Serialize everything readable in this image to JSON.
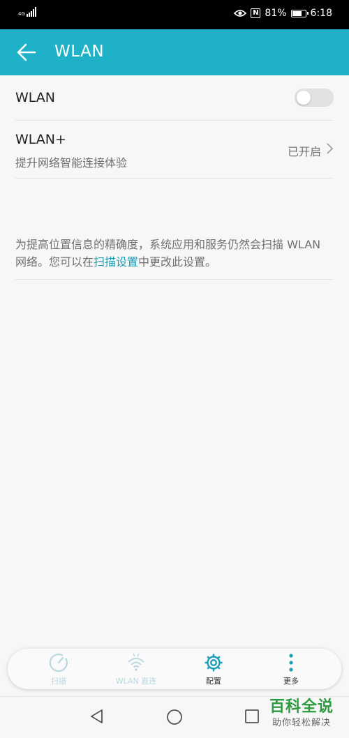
{
  "status_bar": {
    "network": "4G",
    "battery_percent": "81%",
    "battery_level": 0.81,
    "time": "6:18",
    "icons": [
      "signal-icon",
      "eye-icon",
      "nfc-icon",
      "battery-icon"
    ]
  },
  "app_bar": {
    "title": "WLAN",
    "back_icon": "back-arrow-icon"
  },
  "settings": {
    "wlan": {
      "label": "WLAN",
      "enabled": false
    },
    "wlan_plus": {
      "label": "WLAN+",
      "subtitle": "提升网络智能连接体验",
      "status": "已开启"
    }
  },
  "info": {
    "text_before": "为提高位置信息的精确度，系统应用和服务仍然会扫描 WLAN 网络。您可以在",
    "link": "扫描设置",
    "text_after": "中更改此设置。"
  },
  "toolbar": {
    "items": [
      {
        "label": "扫描",
        "icon": "scan-icon",
        "enabled": false
      },
      {
        "label": "WLAN 直连",
        "icon": "wifi-direct-icon",
        "enabled": false
      },
      {
        "label": "配置",
        "icon": "gear-icon",
        "enabled": true
      },
      {
        "label": "更多",
        "icon": "more-vertical-icon",
        "enabled": true
      }
    ]
  },
  "nav_bar": {
    "icons": [
      "nav-back-icon",
      "nav-home-icon",
      "nav-recent-icon"
    ]
  },
  "watermark": {
    "title": "百科全说",
    "subtitle": "助你轻松解决"
  },
  "colors": {
    "accent": "#1fb1c7",
    "link": "#1a9fb6",
    "toolbar_active_icon": "#1a9fb6",
    "toolbar_disabled_icon": "#b9d8de",
    "watermark_green": "#2c9a3f"
  }
}
